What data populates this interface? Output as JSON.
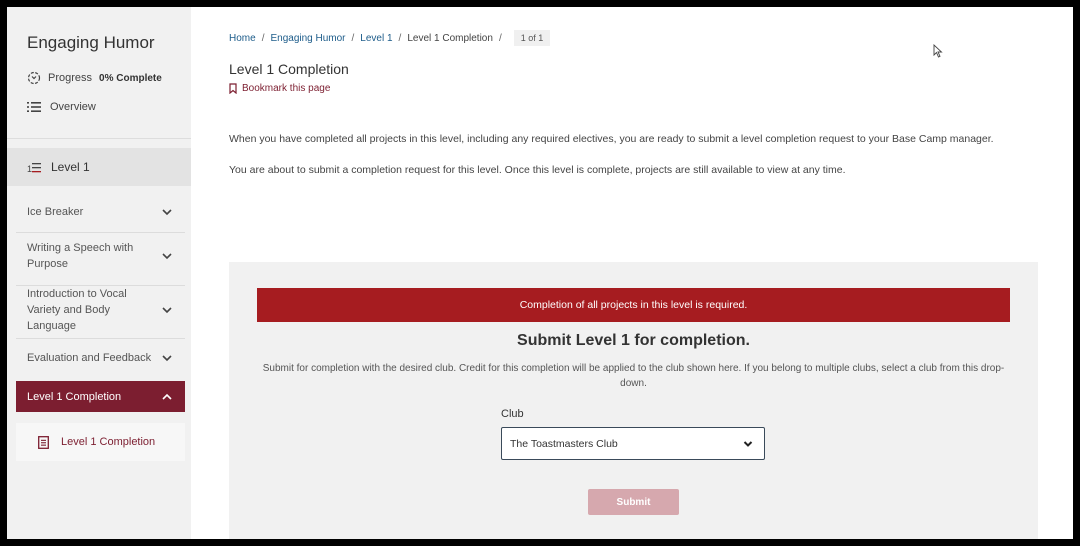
{
  "sidebar": {
    "course_title": "Engaging Humor",
    "progress_label": "Progress",
    "progress_value": "0% Complete",
    "overview_label": "Overview",
    "level_label": "Level 1",
    "items": [
      {
        "label": "Ice Breaker"
      },
      {
        "label": "Writing a Speech with Purpose"
      },
      {
        "label": "Introduction to Vocal Variety and Body Language"
      },
      {
        "label": "Evaluation and Feedback"
      },
      {
        "label": "Level 1 Completion"
      }
    ],
    "sub_item": "Level 1 Completion"
  },
  "breadcrumb": {
    "home": "Home",
    "course": "Engaging Humor",
    "level": "Level 1",
    "current": "Level 1 Completion",
    "pager": "1 of 1"
  },
  "main": {
    "title": "Level 1 Completion",
    "bookmark": "Bookmark this page",
    "para1": "When you have completed all projects in this level, including any required electives, you are ready to submit a level completion request to your Base Camp manager.",
    "para2": "You are about to submit a completion request for this level. Once this level is complete, projects are still available to view at any time."
  },
  "panel": {
    "alert": "Completion of all projects in this level is required.",
    "title": "Submit Level 1 for completion.",
    "description": "Submit for completion with the desired club. Credit for this completion will be applied to the club shown here. If you belong to multiple clubs, select a club from this drop-down.",
    "club_label": "Club",
    "club_value": "The Toastmasters Club",
    "submit_label": "Submit"
  },
  "colors": {
    "brand": "#7c1e30",
    "alert": "#a61c20",
    "link": "#1d5c8a",
    "submit_disabled": "#d6a8ae"
  }
}
